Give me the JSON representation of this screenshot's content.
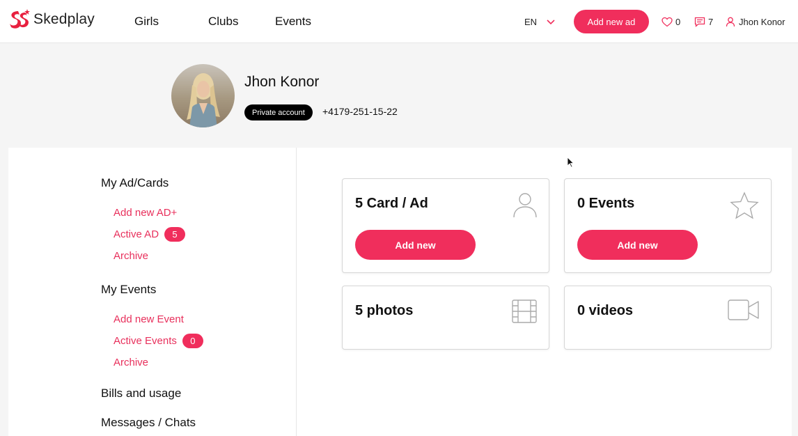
{
  "header": {
    "brand": "Skedplay",
    "nav": [
      "Girls",
      "Clubs",
      "Events"
    ],
    "language": "EN",
    "add_ad_label": "Add new ad",
    "favorites_count": "0",
    "messages_count": "7",
    "user_name": "Jhon Konor",
    "accent_color": "#f02e5c"
  },
  "profile": {
    "name": "Jhon Konor",
    "account_type": "Private account",
    "phone": "+4179-251-15-22"
  },
  "sidebar": {
    "ads_heading": "My Ad/Cards",
    "ads_links": {
      "add_new": "Add new AD+",
      "active": "Active AD",
      "active_count": "5",
      "archive": "Archive"
    },
    "events_heading": "My Events",
    "events_links": {
      "add_new": "Add new Event",
      "active": "Active Events",
      "active_count": "0",
      "archive": "Archive"
    },
    "bills_label": "Bills and usage",
    "messages_label": "Messages / Chats"
  },
  "cards": {
    "ads": {
      "title": "5 Card / Ad",
      "button": "Add new",
      "icon": "user-icon"
    },
    "events": {
      "title": "0 Events",
      "button": "Add new",
      "icon": "star-icon"
    },
    "photos": {
      "title": "5 photos",
      "icon": "film-icon"
    },
    "videos": {
      "title": "0 videos",
      "icon": "video-camera-icon"
    }
  }
}
